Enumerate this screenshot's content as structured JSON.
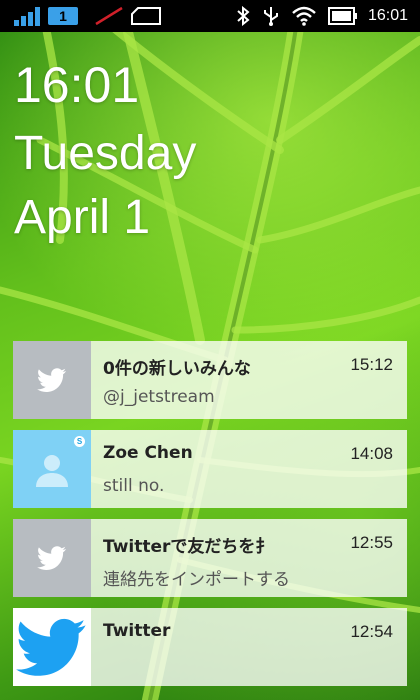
{
  "status_bar": {
    "sim_slot": "1",
    "time": "16:01"
  },
  "lock_screen": {
    "time": "16:01",
    "day": "Tuesday",
    "date": "April 1"
  },
  "notifications": [
    {
      "title": "0件の新しいみんな",
      "time": "15:12",
      "text": "@j_jetstream",
      "icon": "twitter-bird-icon"
    },
    {
      "title": "Zoe Chen",
      "time": "14:08",
      "text": "still no.",
      "icon": "contact-avatar-icon"
    },
    {
      "title": "Twitterで友だちを扌",
      "time": "12:55",
      "text": "連絡先をインポートする",
      "icon": "twitter-bird-icon"
    },
    {
      "title": "Twitter",
      "time": "12:54",
      "text": "",
      "icon": "twitter-logo-icon"
    }
  ],
  "colors": {
    "status_bar_bg": "#000000",
    "signal_accent": "#3aa0e8",
    "wallpaper_green": "#6cc81e",
    "twitter_blue": "#1da1f2",
    "skype_blue": "#7fd1f5"
  }
}
